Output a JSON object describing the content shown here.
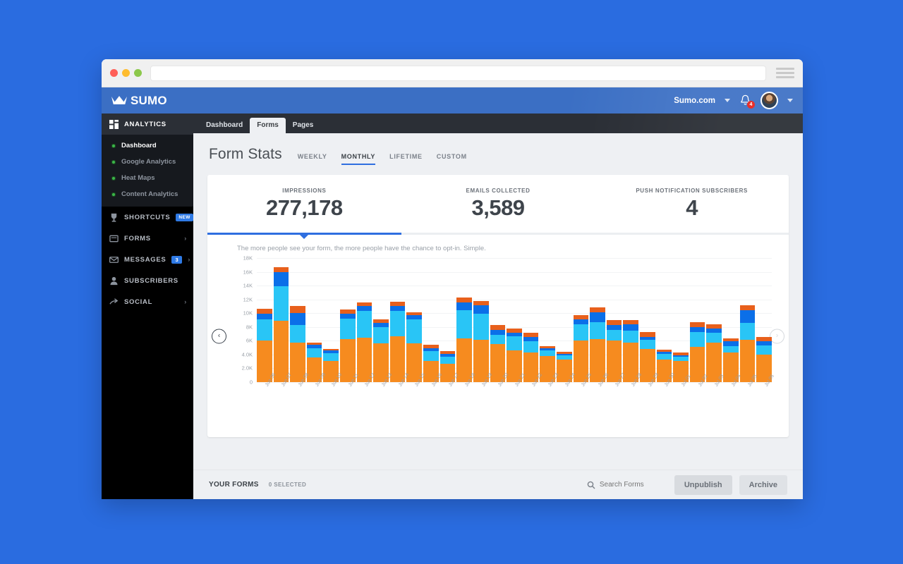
{
  "browser": {
    "menu_icon": "hamburger-icon",
    "url_value": "",
    "url_placeholder": ""
  },
  "topbar": {
    "brand": "SUMO",
    "site": "Sumo.com",
    "notification_count": "4",
    "logo_icon": "crown-icon",
    "bell_icon": "bell-icon",
    "avatar_icon": "user-avatar"
  },
  "sidebar": {
    "sections": [
      {
        "label": "ANALYTICS",
        "icon": "grid-icon",
        "active": true
      },
      {
        "label": "SHORTCUTS",
        "icon": "trophy-icon",
        "tag": "NEW"
      },
      {
        "label": "FORMS",
        "icon": "form-icon",
        "chevron": "›"
      },
      {
        "label": "MESSAGES",
        "icon": "envelope-icon",
        "count": "3",
        "chevron": "›"
      },
      {
        "label": "SUBSCRIBERS",
        "icon": "person-icon"
      },
      {
        "label": "SOCIAL",
        "icon": "share-icon",
        "chevron": "›"
      }
    ],
    "analytics_items": [
      {
        "label": "Dashboard",
        "active": true
      },
      {
        "label": "Google Analytics",
        "active": false
      },
      {
        "label": "Heat Maps",
        "active": false
      },
      {
        "label": "Content Analytics",
        "active": false
      }
    ]
  },
  "tabs": [
    {
      "label": "Dashboard",
      "active": false
    },
    {
      "label": "Forms",
      "active": true
    },
    {
      "label": "Pages",
      "active": false
    }
  ],
  "page": {
    "title": "Form Stats",
    "periods": [
      {
        "label": "WEEKLY",
        "active": false
      },
      {
        "label": "MONTHLY",
        "active": true
      },
      {
        "label": "LIFETIME",
        "active": false
      },
      {
        "label": "CUSTOM",
        "active": false
      }
    ]
  },
  "kpis": [
    {
      "label": "IMPRESSIONS",
      "value": "277,178",
      "active": true
    },
    {
      "label": "EMAILS COLLECTED",
      "value": "3,589",
      "active": false
    },
    {
      "label": "PUSH NOTIFICATION SUBSCRIBERS",
      "value": "4",
      "active": false
    }
  ],
  "chart_caption": "The more people see your form, the more people have the chance to opt-in. Simple.",
  "carousel": {
    "prev_icon": "chevron-left-icon",
    "next_icon": "chevron-right-icon",
    "prev_glyph": "‹",
    "next_glyph": "›"
  },
  "footer": {
    "title": "YOUR FORMS",
    "selected": "0 SELECTED",
    "search_icon": "search-icon",
    "search_placeholder": "Search Forms",
    "search_value": "",
    "unpublish_label": "Unpublish",
    "archive_label": "Archive"
  },
  "colors": {
    "accent": "#2f6fe0",
    "page_bg": "#2a6ce0",
    "sidebar_bg": "#000000",
    "series_orange": "#f68b1f",
    "series_cyan": "#29c5f6",
    "series_blue": "#0b6fe8",
    "series_darkorange": "#e8601c"
  },
  "chart_data": {
    "type": "bar",
    "stacked": true,
    "title": "",
    "xlabel": "",
    "ylabel": "",
    "ylim": [
      0,
      18000
    ],
    "grid": true,
    "legend": "none",
    "ytick_labels": [
      "0",
      "2.0K",
      "4.0K",
      "6K",
      "8K",
      "10K",
      "12K",
      "14K",
      "16K",
      "18K"
    ],
    "ytick_values": [
      0,
      2000,
      4000,
      6000,
      8000,
      10000,
      12000,
      14000,
      16000,
      18000
    ],
    "categories": [
      "Jun 06",
      "Jun 07",
      "Jun 08",
      "Jun 09",
      "Jun 10",
      "Jun 11",
      "Jun 12",
      "Jun 13",
      "Jun 14",
      "Jun 15",
      "Jun 16",
      "Jun 17",
      "Jun 18",
      "Jun 19",
      "Jun 20",
      "Jun 21",
      "Jun 22",
      "Jun 23",
      "Jun 24",
      "Jun 25",
      "Jun 26",
      "Jun 27",
      "Jun 28",
      "Jun 29",
      "Jun 30",
      "Jul 01",
      "Jul 02",
      "Jul 03",
      "Jul 04",
      "Jul 05",
      "Jul 06"
    ],
    "series": [
      {
        "name": "orange",
        "color": "#f68b1f",
        "values": [
          6000,
          8900,
          5700,
          3600,
          3100,
          6200,
          6400,
          5600,
          6700,
          5600,
          3100,
          2700,
          6300,
          6100,
          5500,
          4600,
          4300,
          3800,
          3300,
          6000,
          6200,
          6000,
          5700,
          4800,
          3300,
          3100,
          5100,
          5700,
          4300,
          6100,
          4000
        ]
      },
      {
        "name": "cyan",
        "color": "#29c5f6",
        "values": [
          3100,
          5000,
          2600,
          1300,
          1100,
          3000,
          3900,
          2400,
          3600,
          3500,
          1400,
          1000,
          4100,
          3800,
          1400,
          2000,
          1600,
          800,
          600,
          2400,
          2500,
          1600,
          1800,
          1300,
          800,
          600,
          2200,
          1500,
          900,
          2500,
          1300
        ]
      },
      {
        "name": "blue",
        "color": "#0b6fe8",
        "values": [
          800,
          2100,
          1700,
          500,
          400,
          700,
          800,
          600,
          800,
          600,
          400,
          400,
          1200,
          1300,
          700,
          600,
          600,
          300,
          200,
          700,
          1400,
          700,
          900,
          500,
          300,
          200,
          700,
          600,
          700,
          1800,
          600
        ]
      },
      {
        "name": "darkorange",
        "color": "#e8601c",
        "values": [
          700,
          700,
          1000,
          300,
          200,
          600,
          500,
          500,
          600,
          400,
          500,
          400,
          700,
          600,
          700,
          600,
          700,
          300,
          300,
          600,
          700,
          700,
          600,
          700,
          300,
          400,
          700,
          600,
          400,
          700,
          600
        ]
      }
    ]
  }
}
